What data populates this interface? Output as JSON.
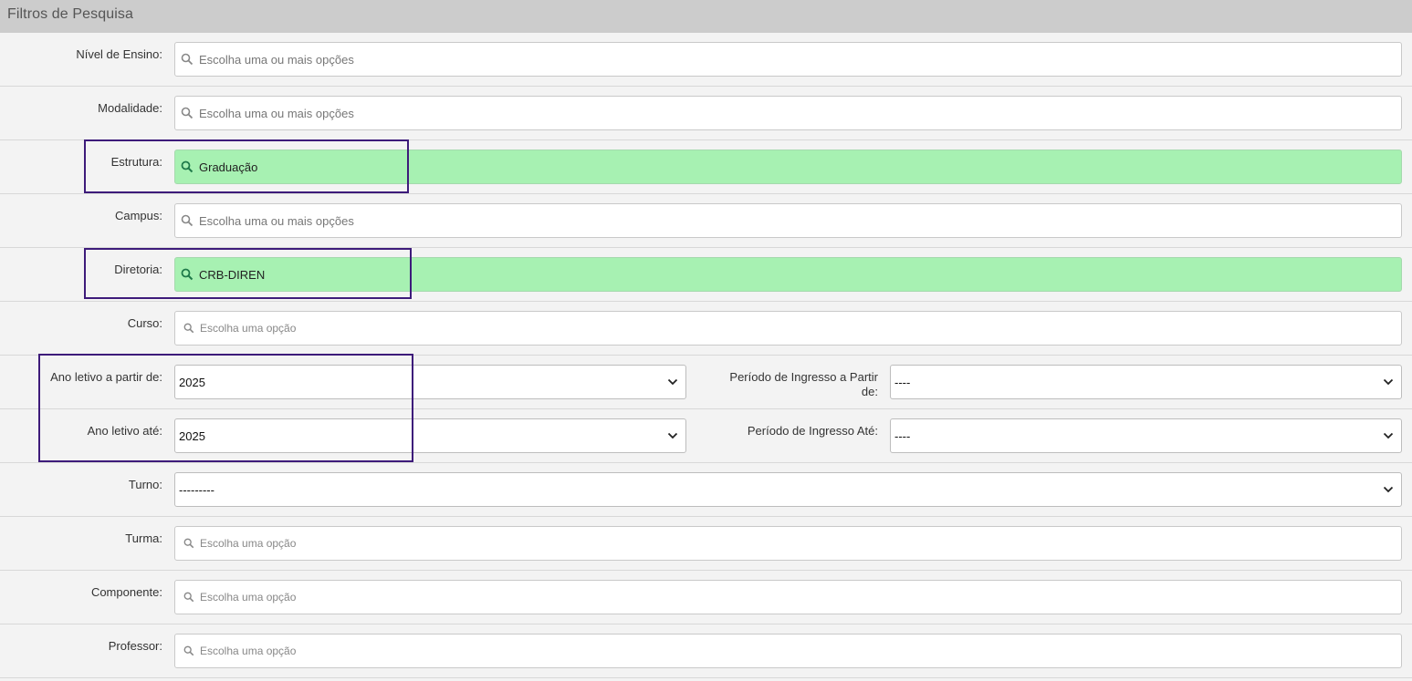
{
  "header": {
    "title": "Filtros de Pesquisa"
  },
  "fields": {
    "nivel": {
      "label": "Nível de Ensino:",
      "placeholder": "Escolha uma ou mais opções"
    },
    "modalidade": {
      "label": "Modalidade:",
      "placeholder": "Escolha uma ou mais opções"
    },
    "estrutura": {
      "label": "Estrutura:",
      "value": "Graduação"
    },
    "campus": {
      "label": "Campus:",
      "placeholder": "Escolha uma ou mais opções"
    },
    "diretoria": {
      "label": "Diretoria:",
      "value": "CRB-DIREN"
    },
    "curso": {
      "label": "Curso:",
      "placeholder": "Escolha uma opção"
    },
    "ano_inicio": {
      "label": "Ano letivo a partir de:",
      "value": "2025"
    },
    "periodo_inicio": {
      "label": "Período de Ingresso a Partir de:",
      "value": "----"
    },
    "ano_fim": {
      "label": "Ano letivo até:",
      "value": "2025"
    },
    "periodo_fim": {
      "label": "Período de Ingresso Até:",
      "value": "----"
    },
    "turno": {
      "label": "Turno:",
      "value": "---------"
    },
    "turma": {
      "label": "Turma:",
      "placeholder": "Escolha uma opção"
    },
    "componente": {
      "label": "Componente:",
      "placeholder": "Escolha uma opção"
    },
    "professor": {
      "label": "Professor:",
      "placeholder": "Escolha uma opção"
    }
  },
  "colors": {
    "filled": "#a7f1b2",
    "highlight": "#3d1b7a",
    "header": "#cccccc"
  },
  "icons": {
    "search": "search-icon",
    "chevron": "chevron-down-icon"
  }
}
